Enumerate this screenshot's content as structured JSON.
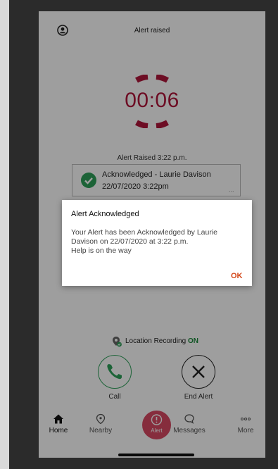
{
  "header": {
    "title": "Alert raised",
    "profile_icon": "profile-icon"
  },
  "timer": {
    "value": "00:06",
    "color": "#b1163b"
  },
  "alert_raised_text": "Alert Raised 3:22 p.m.",
  "ack_card": {
    "line1": "Acknowledged - Laurie Davison",
    "line2": "22/07/2020 3:22pm",
    "more": "...",
    "check_color": "#2ea15a"
  },
  "location": {
    "label": "Location Recording",
    "status": "ON",
    "status_color": "#1b8a3a"
  },
  "actions": {
    "call_label": "Call",
    "end_label": "End Alert"
  },
  "nav": {
    "home": "Home",
    "nearby": "Nearby",
    "alert": "Alert",
    "messages": "Messages",
    "more": "More"
  },
  "dialog": {
    "title": "Alert Acknowledged",
    "body_line1": "Your Alert has been Acknowledged by Laurie",
    "body_line2": "Davison on 22/07/2020 at 3:22 p.m.",
    "body_line3": "Help is on the way",
    "ok_label": "OK",
    "ok_color": "#d4491c"
  }
}
